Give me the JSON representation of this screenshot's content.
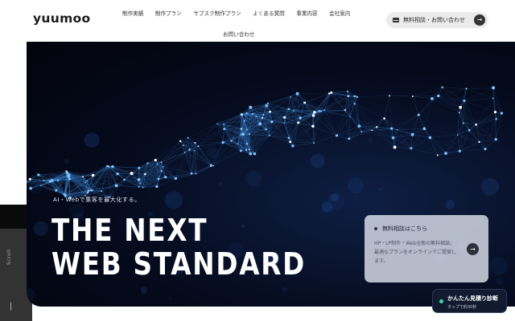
{
  "header": {
    "logo": "yuumoo",
    "nav": [
      {
        "label": "制作実績"
      },
      {
        "label": "制作プラン"
      },
      {
        "label": "サブスク制作プラン"
      },
      {
        "label": "よくある質問"
      },
      {
        "label": "事業内容"
      },
      {
        "label": "会社案内"
      }
    ],
    "nav_contact": "お問い合わせ",
    "cta": {
      "label": "無料相談・お問い合わせ",
      "icon": "mail-icon",
      "arrow": "→"
    }
  },
  "hero": {
    "tagline": "AI・Webで集客を最大化する。",
    "headline_line1": "THE NEXT",
    "headline_line2": "WEB STANDARD",
    "background": "network-particles"
  },
  "consult_card": {
    "title": "無料相談はこちら",
    "text": "HP・LP制作・Web全般の無料相談。最適なプランをオンラインでご提案します。",
    "arrow": "→"
  },
  "estimate": {
    "title": "かんたん見積り診断",
    "subtitle": "タップで約30秒",
    "accent": "#3ad6b0"
  },
  "scroll": {
    "label": "Scroll"
  },
  "colors": {
    "hero_bg": "#050a1c",
    "network": "#4aa3ff",
    "card": "#dce1eb"
  }
}
